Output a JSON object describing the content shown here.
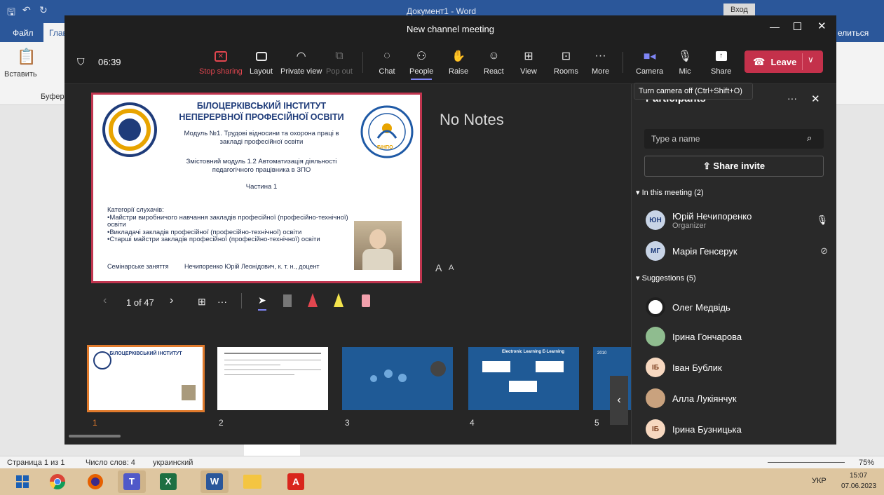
{
  "word": {
    "title": "Документ1 - Word",
    "login_button": "Вход",
    "tab_file": "Файл",
    "tab_home": "Глав",
    "share": "елиться",
    "paste": "Вставить",
    "clipboard": "Буфер о",
    "status_page": "Страница 1 из 1",
    "status_words": "Число слов: 4",
    "status_lang": "украинский",
    "zoom": "75%"
  },
  "taskbar": {
    "lang": "УКР",
    "time": "15:07",
    "date": "07.06.2023"
  },
  "teams": {
    "window_title": "New channel meeting",
    "timer": "06:39",
    "tools": {
      "stop_sharing": "Stop sharing",
      "layout": "Layout",
      "private_view": "Private view",
      "pop_out": "Pop out",
      "chat": "Chat",
      "people": "People",
      "raise": "Raise",
      "react": "React",
      "view": "View",
      "rooms": "Rooms",
      "more": "More",
      "camera": "Camera",
      "mic": "Mic",
      "share": "Share",
      "leave": "Leave"
    },
    "tooltip": "Turn camera off (Ctrl+Shift+O)",
    "notes": "No Notes",
    "font_large": "A",
    "font_small": "A",
    "slide_counter": "1 of 47",
    "slide": {
      "header1": "БІЛОЦЕРКІВСЬКИЙ ІНСТИТУТ",
      "header2": "НЕПЕРЕРВНОЇ ПРОФЕСІЙНОЇ ОСВІТИ",
      "module": "Модуль №1. Трудові відносини та охорона праці в закладі професійної освіти",
      "submodule": "Змістовний модуль 1.2 Автоматизація діяльності педагогічного працівника в ЗПО",
      "part": "Частина 1",
      "categories_title": "Категорії слухачів:",
      "cat1": "•Майстри виробничого навчання закладів професійної (професійно-технічної) освіти",
      "cat2": "•Викладачі закладів професійної (професійно-технічної) освіти",
      "cat3": "•Старші майстри закладів професійної (професійно-технічної) освіти",
      "footer_left": "Семінарське заняття",
      "footer_right": "Нечипоренко Юрій Леонідович, к. т. н., доцент",
      "logo_text": "БІНПО"
    },
    "thumbnails": [
      {
        "num": "1",
        "label": "БІЛОЦЕРКІВСЬКИЙ ІНСТИТУТ"
      },
      {
        "num": "2",
        "label": ""
      },
      {
        "num": "3",
        "label": ""
      },
      {
        "num": "4",
        "label": "Electronic Learning E-Learning"
      },
      {
        "num": "5",
        "label": "2010"
      }
    ],
    "panel": {
      "title": "Participants",
      "search_placeholder": "Type a name",
      "share_invite": "Share invite",
      "in_meeting": "In this meeting (2)",
      "suggestions": "Suggestions (5)",
      "members": [
        {
          "initials": "ЮН",
          "name": "Юрій Нечипоренко",
          "role": "Organizer",
          "color": "#c8d4e6"
        },
        {
          "initials": "МГ",
          "name": "Марія Генсерук",
          "role": "",
          "color": "#c8d4e6"
        }
      ],
      "suggested": [
        {
          "initials": "",
          "name": "Олег Медвідь",
          "color": "#ffffff"
        },
        {
          "initials": "",
          "name": "Ірина Гончарова",
          "color": "#8fbc8f"
        },
        {
          "initials": "ІБ",
          "name": "Іван Бублик",
          "color": "#f7d8c0"
        },
        {
          "initials": "",
          "name": "Алла Лукіянчук",
          "color": "#c9a27e"
        },
        {
          "initials": "ІБ",
          "name": "Ірина Бузницька",
          "color": "#f7d8c0"
        }
      ]
    }
  }
}
